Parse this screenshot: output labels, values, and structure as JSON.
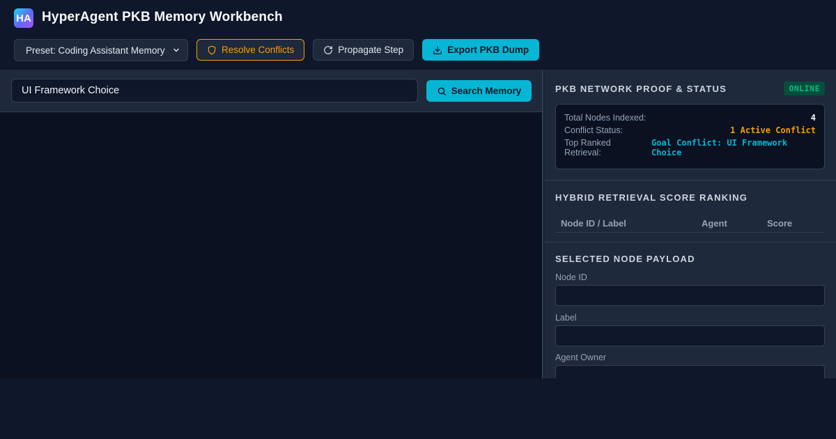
{
  "app": {
    "logo_text": "HA",
    "title": "HyperAgent PKB Memory Workbench"
  },
  "toolbar": {
    "preset_selected": "Preset: Coding Assistant Memory",
    "resolve_label": "Resolve Conflicts",
    "propagate_label": "Propagate Step",
    "export_label": "Export PKB Dump"
  },
  "search": {
    "value": "UI Framework Choice",
    "button_label": "Search Memory"
  },
  "status": {
    "title": "PKB NETWORK PROOF & STATUS",
    "badge": "ONLINE",
    "total_nodes_label": "Total Nodes Indexed:",
    "total_nodes_value": "4",
    "conflict_label": "Conflict Status:",
    "conflict_value": "1 Active Conflict",
    "top_ranked_label": "Top Ranked Retrieval:",
    "top_ranked_value": "Goal Conflict: UI Framework Choice"
  },
  "ranking": {
    "title": "HYBRID RETRIEVAL SCORE RANKING",
    "columns": [
      "Node ID / Label",
      "Agent",
      "Score"
    ]
  },
  "payload": {
    "title": "SELECTED NODE PAYLOAD",
    "node_id_label": "Node ID",
    "label_label": "Label",
    "agent_owner_label": "Agent Owner"
  },
  "colors": {
    "accent": "#06b6d4",
    "warning": "#f59e0b",
    "success": "#10b981",
    "background": "#0f172a"
  },
  "icons": {
    "resolve": "shield-icon",
    "propagate": "refresh-icon",
    "export": "download-icon",
    "search": "search-icon"
  }
}
